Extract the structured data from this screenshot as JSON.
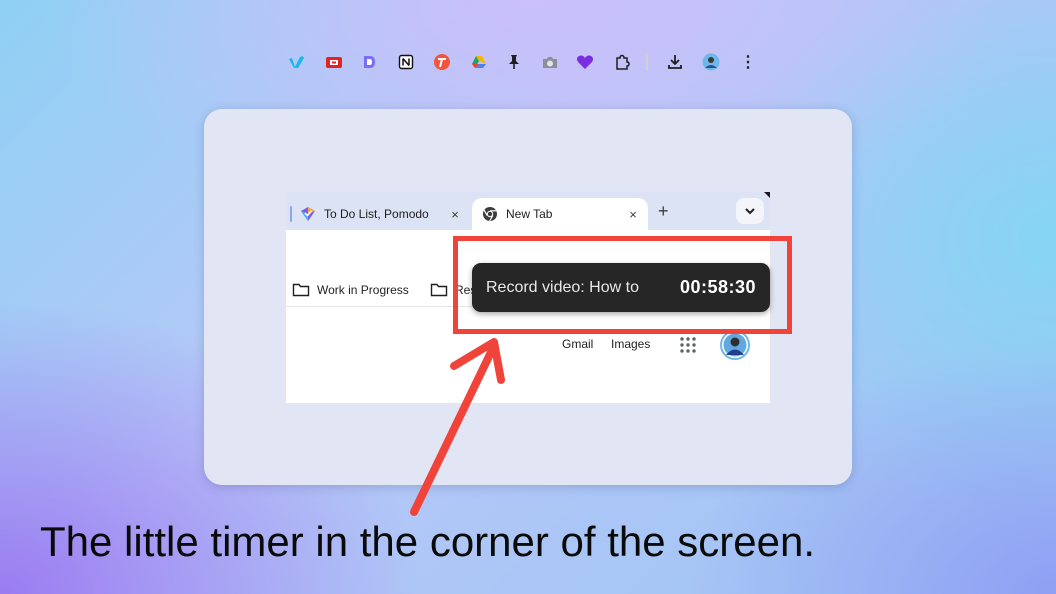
{
  "browser": {
    "tabs": [
      {
        "title": "To Do List, Pomodo",
        "close": "×"
      },
      {
        "title": "New Tab",
        "close": "×"
      }
    ],
    "new_tab_symbol": "+",
    "tab_menu_symbol": "⌄",
    "bookmarks": [
      {
        "label": "Work in Progress"
      },
      {
        "label": "Res"
      }
    ],
    "ntp_links": {
      "gmail": "Gmail",
      "images": "Images"
    },
    "more_symbol": "⋮"
  },
  "timer_popup": {
    "task": "Record video: How to",
    "time": "00:58:30"
  },
  "caption": "The little timer in the corner of the screen.",
  "colors": {
    "highlight": "#f0443a",
    "popup_bg": "#262626",
    "card_bg": "#e2e6f4"
  },
  "icons": [
    "vimeo-icon",
    "youtube-icon",
    "d-app-icon",
    "notion-icon",
    "t-app-icon",
    "google-drive-icon",
    "pin-icon",
    "camera-icon",
    "heart-icon",
    "extensions-icon",
    "download-icon",
    "profile-avatar-icon",
    "more-icon"
  ]
}
